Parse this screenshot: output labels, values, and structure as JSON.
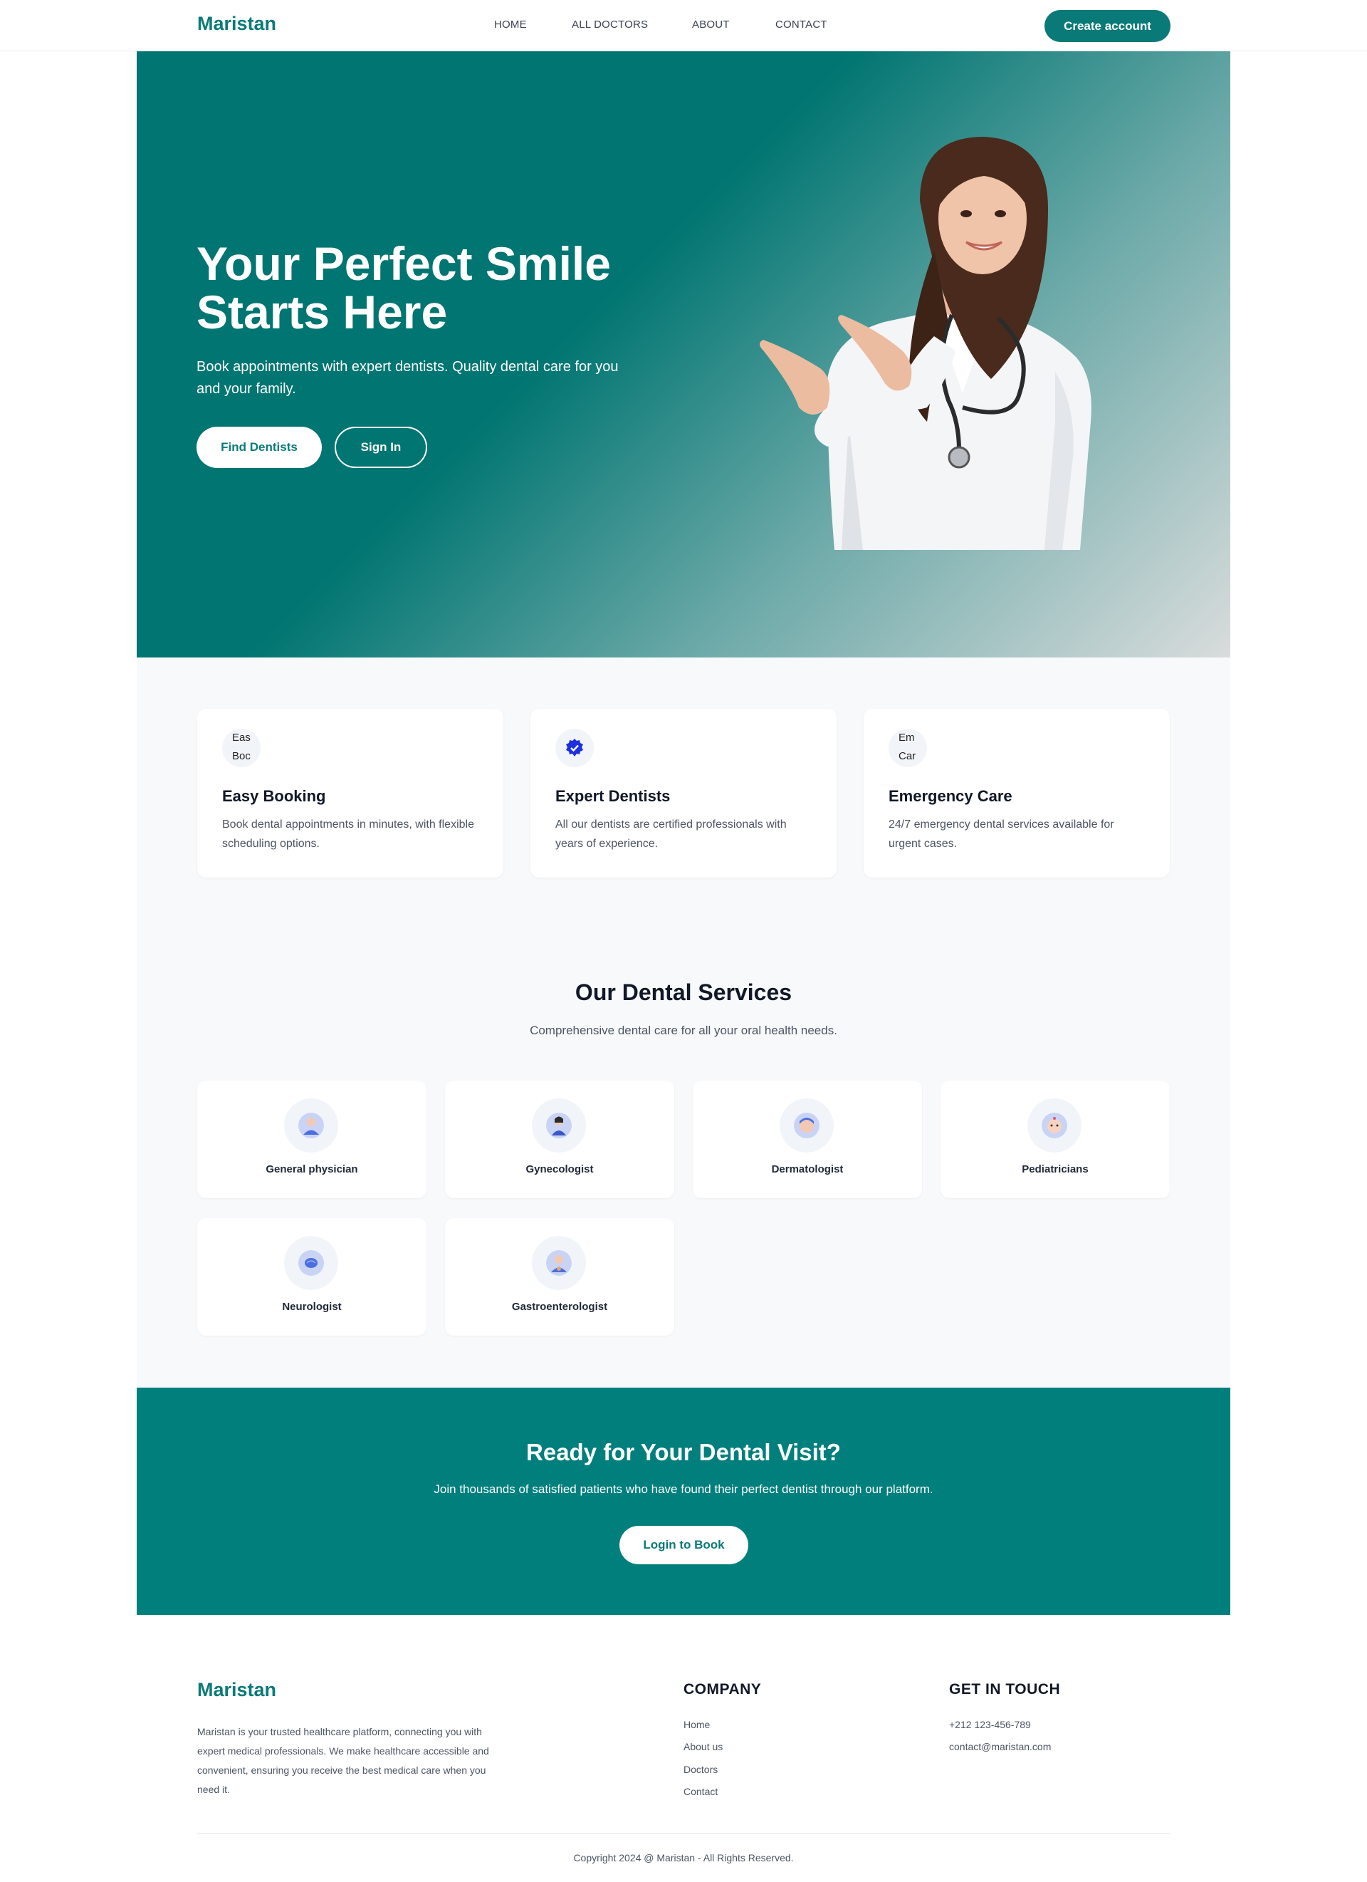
{
  "brand": "Maristan",
  "nav": [
    "HOME",
    "ALL DOCTORS",
    "ABOUT",
    "CONTACT"
  ],
  "header": {
    "cta": "Create account"
  },
  "hero": {
    "title_line1": "Your Perfect Smile",
    "title_line2": "Starts Here",
    "subtitle": "Book appointments with expert dentists. Quality dental care for you and your family.",
    "primary_button": "Find Dentists",
    "secondary_button": "Sign In"
  },
  "features": [
    {
      "title": "Easy Booking",
      "text": "Book dental appointments in minutes, with flexible scheduling options.",
      "broken_alt": "Eas Boc",
      "icon": "calendar-icon"
    },
    {
      "title": "Expert Dentists",
      "text": "All our dentists are certified professionals with years of experience.",
      "icon": "verified-badge-icon"
    },
    {
      "title": "Emergency Care",
      "text": "24/7 emergency dental services available for urgent cases.",
      "broken_alt": "Em Car",
      "icon": "emergency-icon"
    }
  ],
  "services": {
    "title": "Our Dental Services",
    "subtitle": "Comprehensive dental care for all your oral health needs.",
    "items": [
      "General physician",
      "Gynecologist",
      "Dermatologist",
      "Pediatricians",
      "Neurologist",
      "Gastroenterologist"
    ]
  },
  "cta": {
    "title": "Ready for Your Dental Visit?",
    "text": "Join thousands of satisfied patients who have found their perfect dentist through our platform.",
    "button": "Login to Book"
  },
  "footer": {
    "brand": "Maristan",
    "description": "Maristan is your trusted healthcare platform, connecting you with expert medical professionals. We make healthcare accessible and convenient, ensuring you receive the best medical care when you need it.",
    "company_heading": "COMPANY",
    "company_links": [
      "Home",
      "About us",
      "Doctors",
      "Contact"
    ],
    "contact_heading": "GET IN TOUCH",
    "phone": "+212 123-456-789",
    "email": "contact@maristan.com",
    "copyright": "Copyright 2024 @ Maristan - All Rights Reserved."
  },
  "colors": {
    "primary": "#0a7a78",
    "cta_bg": "#007f7d",
    "light_bg": "#f8f9fb"
  }
}
